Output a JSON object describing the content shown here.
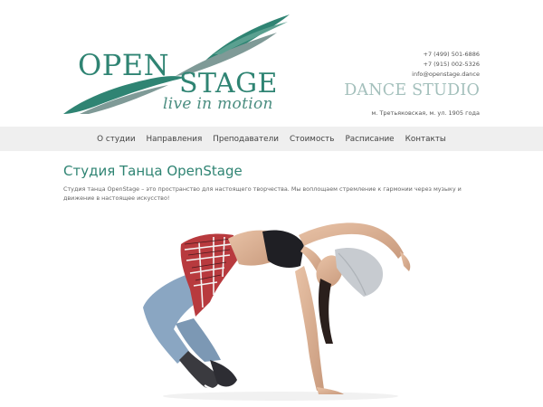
{
  "logo": {
    "word1": "OPEN",
    "word2": "STAGE",
    "tagline": "live in motion",
    "colors": {
      "primary": "#2f8473",
      "secondary": "#7f9a97"
    }
  },
  "contacts": {
    "phone1": "+7 (499) 501-6886",
    "phone2": "+7 (915) 002-5326",
    "email": "info@openstage.dance"
  },
  "studio_title": "DANCE STUDIO",
  "address": "м. Третьяковская, м. ул. 1905 года",
  "nav": {
    "items": [
      {
        "label": "О студии"
      },
      {
        "label": "Направления"
      },
      {
        "label": "Преподаватели"
      },
      {
        "label": "Стоимость"
      },
      {
        "label": "Расписание"
      },
      {
        "label": "Контакты"
      }
    ]
  },
  "main": {
    "heading": "Студия Танца OpenStage",
    "intro": "Студия танца OpenStage – это пространство для настоящего творчества. Мы воплощаем стремление к гармонии через музыку и движение в настоящее искусство!"
  },
  "colors": {
    "accent": "#2f8473",
    "nav_bg": "#efefef",
    "studio_title": "#a4c0bc"
  }
}
